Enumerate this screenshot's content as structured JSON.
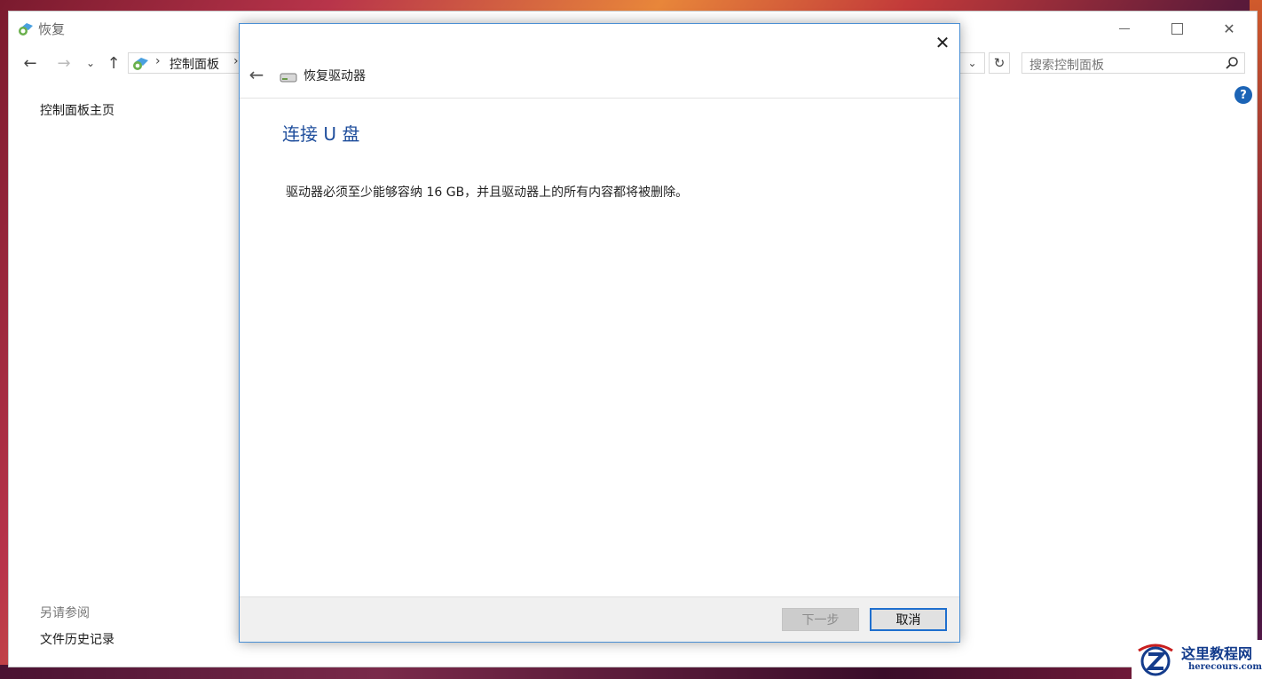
{
  "window": {
    "title": "恢复"
  },
  "nav": {
    "address_item": "控制面板",
    "search_placeholder": "搜索控制面板"
  },
  "sidebar": {
    "home_link": "控制面板主页",
    "see_also_heading": "另请参阅",
    "file_history_link": "文件历史记录"
  },
  "dialog": {
    "title": "恢复驱动器",
    "heading": "连接 U 盘",
    "body": "驱动器必须至少能够容纳 16 GB，并且驱动器上的所有内容都将被删除。",
    "next_label": "下一步",
    "cancel_label": "取消",
    "next_enabled": false
  },
  "help": {
    "label": "?"
  },
  "watermark": {
    "name": "这里教程网",
    "domain": "herecours.com"
  },
  "colors": {
    "heading": "#1f4e9c",
    "accent_border": "#4a8fd4",
    "help": "#1c64b6"
  }
}
